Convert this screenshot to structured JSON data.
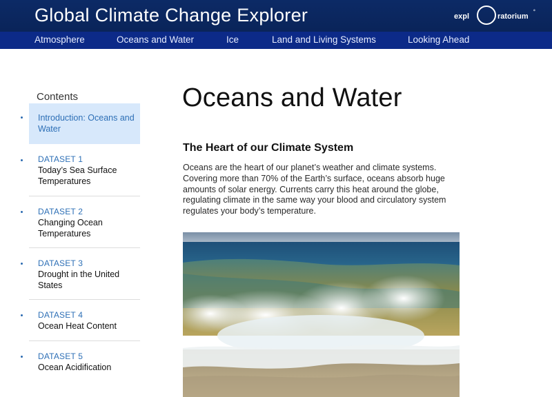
{
  "header": {
    "site_title": "Global Climate Change Explorer",
    "logo_text_left": "expl",
    "logo_text_right": "ratorium",
    "logo_mark": "°"
  },
  "nav": [
    {
      "label": "Atmosphere"
    },
    {
      "label": "Oceans and Water"
    },
    {
      "label": "Ice"
    },
    {
      "label": "Land and Living Systems"
    },
    {
      "label": "Looking Ahead"
    }
  ],
  "sidebar": {
    "title": "Contents",
    "items": [
      {
        "tag": "",
        "label": "Introduction: Oceans and Water",
        "active": true
      },
      {
        "tag": "DATASET 1",
        "label": "Today’s Sea Surface Temperatures"
      },
      {
        "tag": "DATASET 2",
        "label": "Changing Ocean Temperatures"
      },
      {
        "tag": "DATASET 3",
        "label": "Drought in the United States"
      },
      {
        "tag": "DATASET 4",
        "label": "Ocean Heat Content"
      },
      {
        "tag": "DATASET 5",
        "label": "Ocean Acidification"
      }
    ]
  },
  "main": {
    "title": "Oceans and Water",
    "section_heading": "The Heart of our Climate System",
    "body": "Oceans are the heart of our planet’s weather and climate systems. Covering more than 70% of the Earth’s surface, oceans absorb huge amounts of solar energy. Currents carry this heat around the globe, regulating climate in the same way your blood and circulatory system regulates your body’s temperature."
  },
  "colors": {
    "header_bg": "#0a2459",
    "nav_bg": "#0c2a88",
    "accent_link": "#2d6fb6",
    "active_item_bg": "#d7e8fb"
  }
}
